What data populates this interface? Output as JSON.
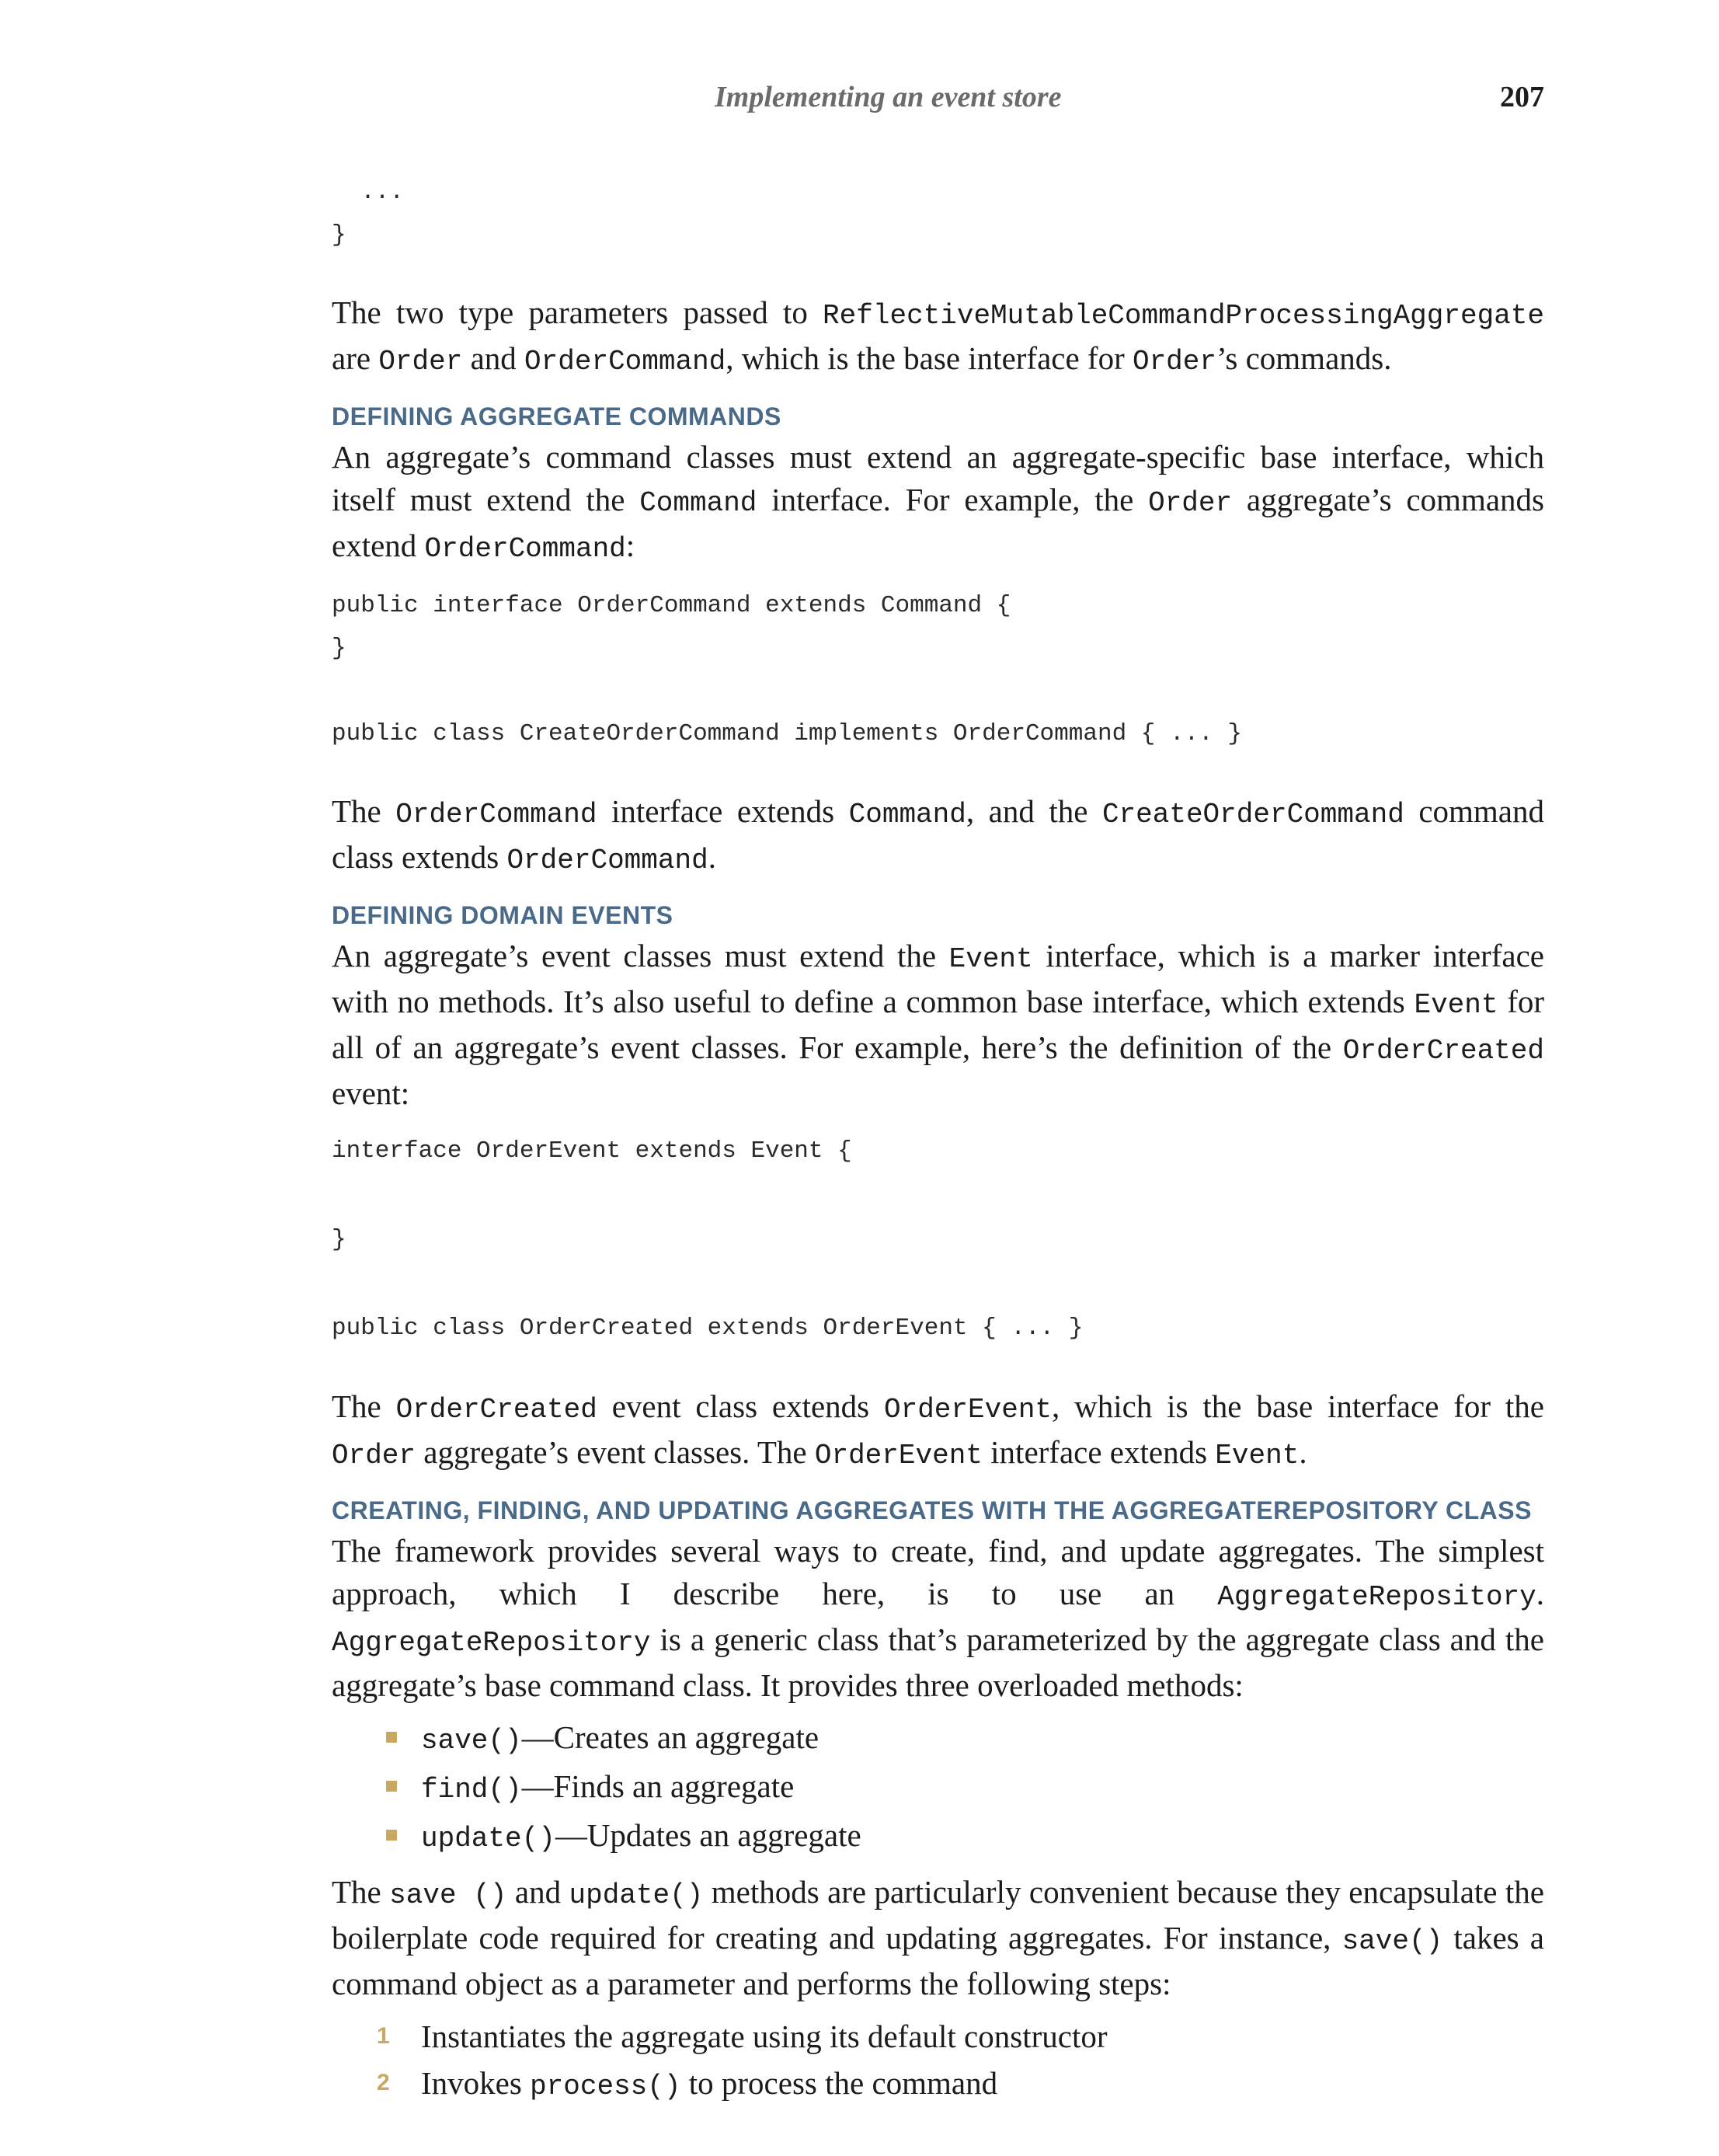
{
  "header": {
    "running_title": "Implementing an event store",
    "page_number": "207"
  },
  "code1": "  ...\n}",
  "p1": {
    "a": "The two type parameters passed to ",
    "b": "ReflectiveMutableCommandProcessingAggregate",
    "c": " are ",
    "d": "Order",
    "e": " and ",
    "f": "OrderCommand",
    "g": ", which is the base interface for ",
    "h": "Order",
    "i": "’s commands."
  },
  "h1": "Defining aggregate commands",
  "p2": {
    "a": "An aggregate’s command classes must extend an aggregate-specific base interface, which itself must extend the ",
    "b": "Command",
    "c": " interface. For example, the ",
    "d": "Order",
    "e": " aggregate’s commands extend ",
    "f": "OrderCommand",
    "g": ":"
  },
  "code2": "public interface OrderCommand extends Command {\n}\n\npublic class CreateOrderCommand implements OrderCommand { ... }",
  "p3": {
    "a": "The ",
    "b": "OrderCommand",
    "c": " interface extends ",
    "d": "Command",
    "e": ", and the ",
    "f": "CreateOrderCommand",
    "g": " command class extends ",
    "h": "OrderCommand",
    "i": "."
  },
  "h2": "Defining domain events",
  "p4": {
    "a": "An aggregate’s event classes must extend the ",
    "b": "Event",
    "c": " interface, which is a marker interface with no methods. It’s also useful to define a common base interface, which extends ",
    "d": "Event",
    "e": " for all of an aggregate’s event classes. For example, here’s the definition of the ",
    "f": "OrderCreated",
    "g": " event:"
  },
  "code3": "interface OrderEvent extends Event {\n\n}\n\npublic class OrderCreated extends OrderEvent { ... }",
  "p5": {
    "a": "The ",
    "b": "OrderCreated",
    "c": " event class extends ",
    "d": "OrderEvent",
    "e": ", which is the base interface for the ",
    "f": "Order",
    "g": " aggregate’s event classes. The ",
    "h": "OrderEvent",
    "i": " interface extends ",
    "j": "Event",
    "k": "."
  },
  "h3": "Creating, finding, and updating aggregates with the AggregateRepository class",
  "p6": {
    "a": "The framework provides several ways to create, find, and update aggregates. The simplest approach, which I describe here, is to use an ",
    "b": "AggregateRepository",
    "c": ". ",
    "d": "AggregateRepository",
    "e": " is a generic class that’s parameterized by the aggregate class and the aggregate’s base command class. It provides three overloaded methods:"
  },
  "bullets": [
    {
      "code": "save()",
      "text": "—Creates an aggregate"
    },
    {
      "code": "find()",
      "text": "—Finds an aggregate"
    },
    {
      "code": "update()",
      "text": "—Updates an aggregate"
    }
  ],
  "p7": {
    "a": "The ",
    "b": "save ()",
    "c": " and ",
    "d": "update()",
    "e": " methods are particularly convenient because they encapsulate the boilerplate code required for creating and updating aggregates. For instance, ",
    "f": "save()",
    "g": " takes a command object as a parameter and performs the following steps:"
  },
  "steps": [
    {
      "num": "1",
      "a": "Instantiates the aggregate using its default constructor",
      "code": "",
      "b": ""
    },
    {
      "num": "2",
      "a": "Invokes ",
      "code": "process()",
      "b": " to process the command"
    }
  ]
}
